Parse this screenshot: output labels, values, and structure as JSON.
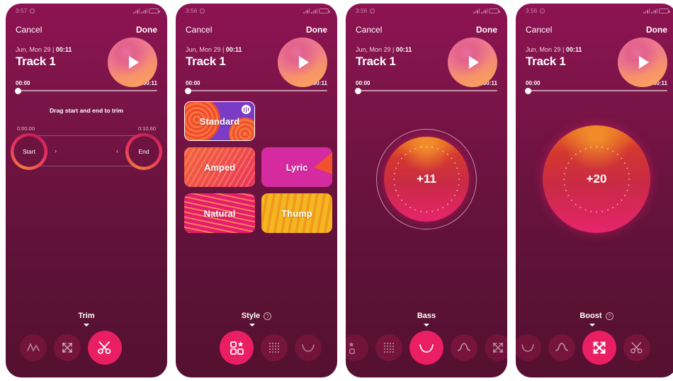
{
  "screens": [
    {
      "id": "trim",
      "statusbar": {
        "time": "3:57",
        "alarm_icon": "alarm-icon",
        "signal_icon": "signal-icon",
        "wifi_icon": "wifi-icon",
        "battery_icon": "battery-icon"
      },
      "topbar": {
        "cancel": "Cancel",
        "done": "Done"
      },
      "track": {
        "meta_date": "Jun, Mon 29 | ",
        "meta_duration": "00:11",
        "title": "Track 1",
        "play_icon": "play-icon"
      },
      "scrubber": {
        "start": "00:00",
        "end": "00:11",
        "position_percent": 0
      },
      "trim": {
        "hint": "Drag start and end to trim",
        "start_time": "0:00.00",
        "end_time": "0:10.60",
        "start_label": "Start",
        "end_label": "End",
        "arrow_right": "›",
        "arrow_left": "‹"
      },
      "bottom": {
        "mode_label": "Trim",
        "has_help": false,
        "active_index": 2
      }
    },
    {
      "id": "style",
      "statusbar": {
        "time": "3:56",
        "alarm_icon": "alarm-icon",
        "signal_icon": "signal-icon",
        "wifi_icon": "wifi-icon",
        "battery_icon": "battery-icon"
      },
      "topbar": {
        "cancel": "Cancel",
        "done": "Done"
      },
      "track": {
        "meta_date": "Jun, Mon 29 | ",
        "meta_duration": "00:11",
        "title": "Track 1",
        "play_icon": "play-icon"
      },
      "scrubber": {
        "start": "00:00",
        "end": "00:11",
        "position_percent": 0
      },
      "styles": [
        {
          "label": "Standard",
          "selected": true,
          "badge": "equalizer-badge-icon"
        },
        {
          "label": "Amped",
          "selected": false
        },
        {
          "label": "Lyric",
          "selected": false
        },
        {
          "label": "Natural",
          "selected": false
        },
        {
          "label": "Thump",
          "selected": false
        }
      ],
      "bottom": {
        "mode_label": "Style",
        "has_help": true,
        "help_glyph": "?",
        "active_index": 0
      }
    },
    {
      "id": "bass",
      "statusbar": {
        "time": "3:56",
        "alarm_icon": "alarm-icon",
        "signal_icon": "signal-icon",
        "wifi_icon": "wifi-icon",
        "battery_icon": "battery-icon"
      },
      "topbar": {
        "cancel": "Cancel",
        "done": "Done"
      },
      "track": {
        "meta_date": "Jun, Mon 29 | ",
        "meta_duration": "00:11",
        "title": "Track 1",
        "play_icon": "play-icon"
      },
      "scrubber": {
        "start": "00:00",
        "end": "00:11",
        "position_percent": 0
      },
      "dial": {
        "value": "+11",
        "has_outer_ring": true,
        "size": "small"
      },
      "bottom": {
        "mode_label": "Bass",
        "has_help": false,
        "active_index": 2
      }
    },
    {
      "id": "boost",
      "statusbar": {
        "time": "3:56",
        "alarm_icon": "alarm-icon",
        "signal_icon": "signal-icon",
        "wifi_icon": "wifi-icon",
        "battery_icon": "battery-icon"
      },
      "topbar": {
        "cancel": "Cancel",
        "done": "Done"
      },
      "track": {
        "meta_date": "Jun, Mon 29 | ",
        "meta_duration": "00:11",
        "title": "Track 1",
        "play_icon": "play-icon"
      },
      "scrubber": {
        "start": "00:00",
        "end": "00:11",
        "position_percent": 0
      },
      "dial": {
        "value": "+20",
        "has_outer_ring": false,
        "size": "large"
      },
      "bottom": {
        "mode_label": "Boost",
        "has_help": true,
        "help_glyph": "?",
        "active_index": 2
      }
    }
  ],
  "colors": {
    "background_top": "#8e1352",
    "background_bottom": "#551031",
    "accent_pink": "#e91e63",
    "accent_orange": "#f07a3c",
    "text_primary": "#ffffff",
    "text_muted": "#e3bccd"
  }
}
